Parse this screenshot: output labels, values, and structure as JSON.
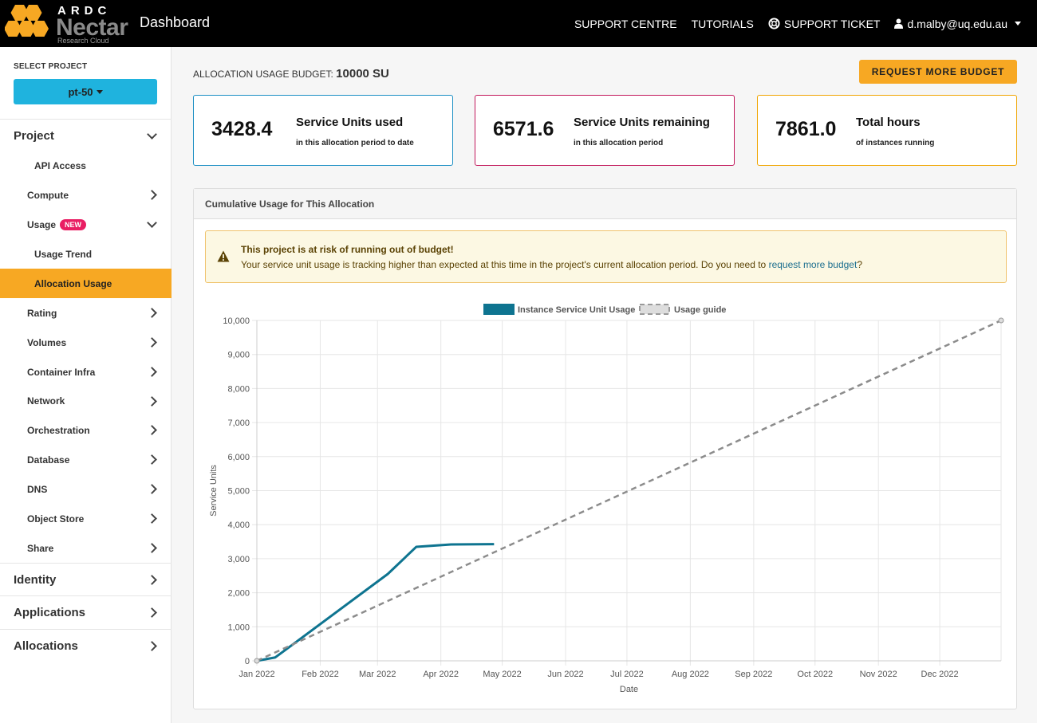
{
  "header": {
    "brand_top": "ARDC",
    "brand_name": "Nectar",
    "brand_sub": "Research Cloud",
    "title": "Dashboard",
    "nav": [
      {
        "label": "SUPPORT CENTRE"
      },
      {
        "label": "TUTORIALS"
      },
      {
        "label": "SUPPORT TICKET",
        "icon": "lifebuoy-icon"
      },
      {
        "label": "d.malby@uq.edu.au",
        "icon": "user-icon"
      }
    ]
  },
  "sidebar": {
    "select_label": "SELECT PROJECT",
    "project": "pt-50",
    "sections": {
      "project": "Project",
      "identity": "Identity",
      "applications": "Applications",
      "allocations": "Allocations"
    },
    "items": {
      "api_access": "API Access",
      "compute": "Compute",
      "usage": "Usage",
      "usage_badge": "NEW",
      "usage_trend": "Usage Trend",
      "allocation_usage": "Allocation Usage",
      "rating": "Rating",
      "volumes": "Volumes",
      "container_infra": "Container Infra",
      "network": "Network",
      "orchestration": "Orchestration",
      "database": "Database",
      "dns": "DNS",
      "object_store": "Object Store",
      "share": "Share"
    }
  },
  "main": {
    "budget_label": "ALLOCATION USAGE BUDGET:",
    "budget_value": "10000 SU",
    "request_button": "REQUEST MORE BUDGET",
    "cards": [
      {
        "value": "3428.4",
        "title": "Service Units used",
        "sub": "in this allocation period to date",
        "color": "#1c8fc4"
      },
      {
        "value": "6571.6",
        "title": "Service Units remaining",
        "sub": "in this allocation period",
        "color": "#c2185b"
      },
      {
        "value": "7861.0",
        "title": "Total hours",
        "sub": "of instances running",
        "color": "#f0a500"
      }
    ],
    "panel_title": "Cumulative Usage for This Allocation",
    "alert": {
      "title": "This project is at risk of running out of budget!",
      "text": "Your service unit usage is tracking higher than expected at this time in the project's current allocation period. Do you need to",
      "link": "request more budget",
      "tail": "?"
    }
  },
  "colors": {
    "accent": "#f7a823",
    "project_button": "#1fb3de",
    "usage_line": "#0e7490",
    "guide_line": "#8c8c8c"
  },
  "chart_data": {
    "type": "line",
    "xlabel": "Date",
    "ylabel": "Service Units",
    "ylim": [
      0,
      10000
    ],
    "yticks": [
      0,
      1000,
      2000,
      3000,
      4000,
      5000,
      6000,
      7000,
      8000,
      9000,
      10000
    ],
    "xlim": [
      "2022-01-01",
      "2022-12-31"
    ],
    "xtick_labels": [
      "Jan 2022",
      "Feb 2022",
      "Mar 2022",
      "Apr 2022",
      "May 2022",
      "Jun 2022",
      "Jul 2022",
      "Aug 2022",
      "Sep 2022",
      "Oct 2022",
      "Nov 2022",
      "Dec 2022"
    ],
    "xtick_dates": [
      "2022-01-01",
      "2022-02-01",
      "2022-03-01",
      "2022-04-01",
      "2022-05-01",
      "2022-06-01",
      "2022-07-01",
      "2022-08-01",
      "2022-09-01",
      "2022-10-01",
      "2022-11-01",
      "2022-12-01"
    ],
    "grid": true,
    "legend": "top",
    "series": [
      {
        "name": "Instance Service Unit Usage",
        "style": "solid",
        "points": [
          {
            "date": "2022-01-01",
            "value": 0
          },
          {
            "date": "2022-01-10",
            "value": 100
          },
          {
            "date": "2022-01-19",
            "value": 500
          },
          {
            "date": "2022-03-06",
            "value": 2550
          },
          {
            "date": "2022-03-20",
            "value": 3350
          },
          {
            "date": "2022-04-06",
            "value": 3420
          },
          {
            "date": "2022-04-27",
            "value": 3428
          }
        ]
      },
      {
        "name": "Usage guide",
        "style": "dashed",
        "points": [
          {
            "date": "2022-01-01",
            "value": 0
          },
          {
            "date": "2022-12-31",
            "value": 10000
          }
        ]
      }
    ]
  }
}
